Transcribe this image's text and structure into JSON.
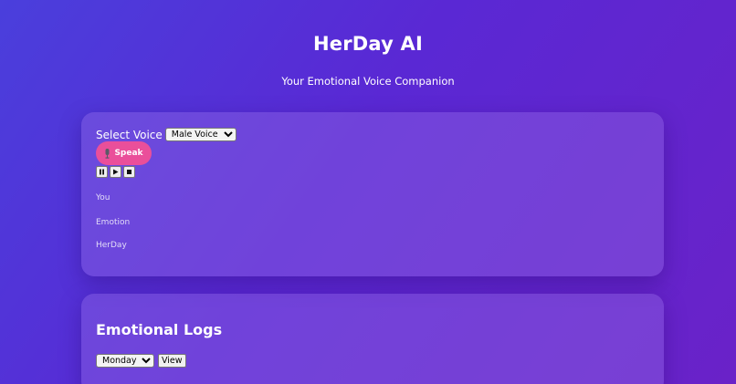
{
  "header": {
    "title": "HerDay AI",
    "subtitle": "Your Emotional Voice Companion"
  },
  "voice_panel": {
    "select_label": "Select Voice",
    "voice_selected": "Male Voice",
    "speak_label": "Speak",
    "speak_icon": "microphone-icon",
    "controls": [
      "pause-icon",
      "play-icon",
      "stop-icon"
    ],
    "lines": {
      "you": "You",
      "emotion": "Emotion",
      "herday": "HerDay"
    }
  },
  "logs_panel": {
    "title": "Emotional Logs",
    "day_selected": "Monday",
    "view_label": "View"
  },
  "colors": {
    "background_start": "#4a3fdc",
    "background_end": "#6a22c8",
    "speak_button": "#ea4f9a",
    "text": "#ffffff"
  }
}
